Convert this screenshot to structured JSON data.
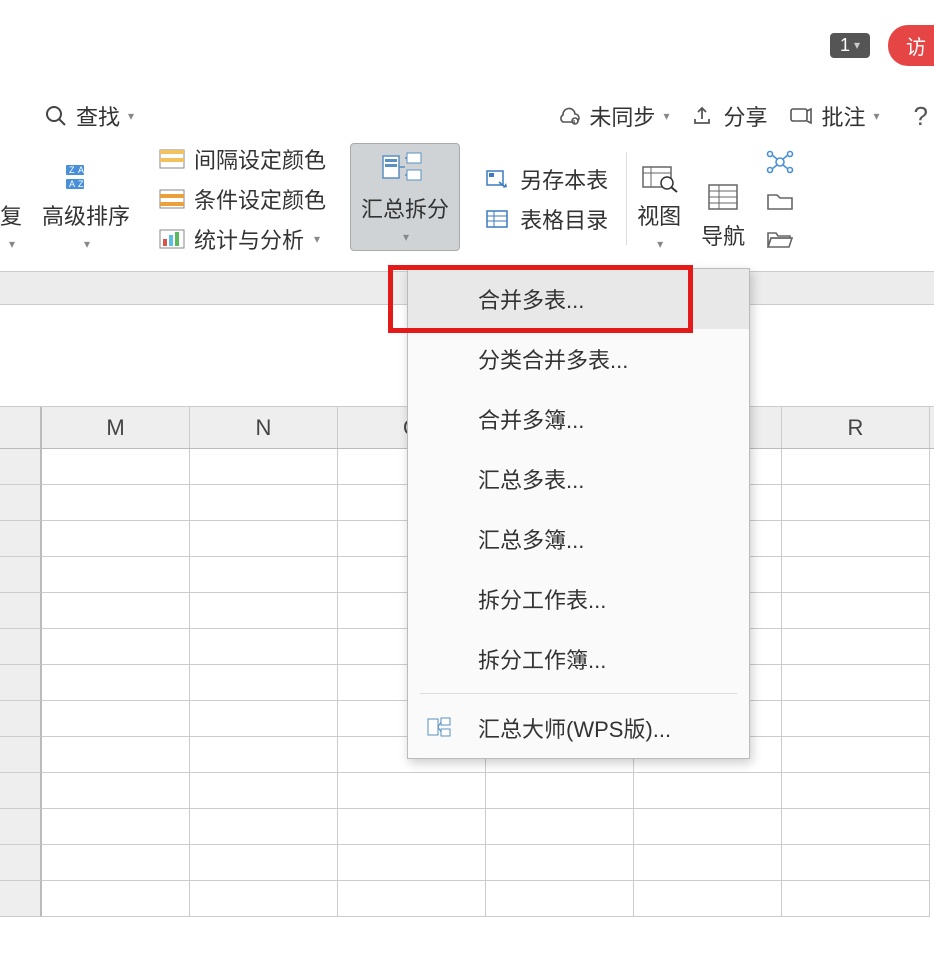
{
  "titlebar": {
    "badge": "1",
    "pill": "访"
  },
  "actions": {
    "search": "查找",
    "unsynced": "未同步",
    "share": "分享",
    "annotate": "批注",
    "help": "?"
  },
  "ribbon": {
    "restore": "复",
    "advanced_sort": "高级排序",
    "interval_color": "间隔设定颜色",
    "condition_color": "条件设定颜色",
    "stats_analysis": "统计与分析",
    "summary_split": "汇总拆分",
    "saveas_sheet": "另存本表",
    "table_toc": "表格目录",
    "view": "视图",
    "navigation": "导航"
  },
  "dropdown": {
    "items": [
      "合并多表...",
      "分类合并多表...",
      "合并多簿...",
      "汇总多表...",
      "汇总多簿...",
      "拆分工作表...",
      "拆分工作簿..."
    ],
    "master": "汇总大师(WPS版)..."
  },
  "columns": [
    "M",
    "N",
    "O",
    "",
    "",
    "R"
  ]
}
